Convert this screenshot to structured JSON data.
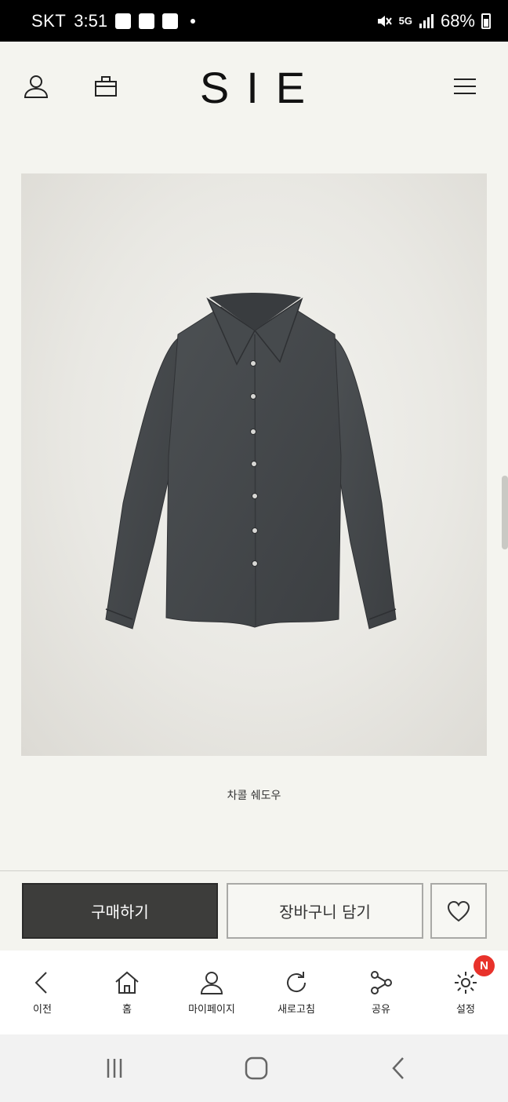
{
  "status_bar": {
    "carrier": "SKT",
    "time": "3:51",
    "network": "5G",
    "battery": "68%"
  },
  "header": {
    "logo": "SIE",
    "icons": [
      "account-icon",
      "shopping-bag-icon",
      "menu-icon"
    ]
  },
  "product": {
    "image_alt": "dark charcoal long-sleeve shirt",
    "title": "차콜 쉐도우"
  },
  "actions": {
    "buy_label": "구매하기",
    "cart_label": "장바구니 담기",
    "wishlist_icon": "heart-icon"
  },
  "toolbar": {
    "items": [
      {
        "label": "이전",
        "icon": "chevron-left-icon"
      },
      {
        "label": "홈",
        "icon": "home-icon"
      },
      {
        "label": "마이페이지",
        "icon": "person-icon"
      },
      {
        "label": "새로고침",
        "icon": "refresh-icon"
      },
      {
        "label": "공유",
        "icon": "share-icon"
      },
      {
        "label": "설정",
        "icon": "gear-icon",
        "badge": "N"
      }
    ]
  },
  "colors": {
    "background": "#f4f4ef",
    "buy_button": "#3d3d3b",
    "badge": "#e8322b"
  }
}
